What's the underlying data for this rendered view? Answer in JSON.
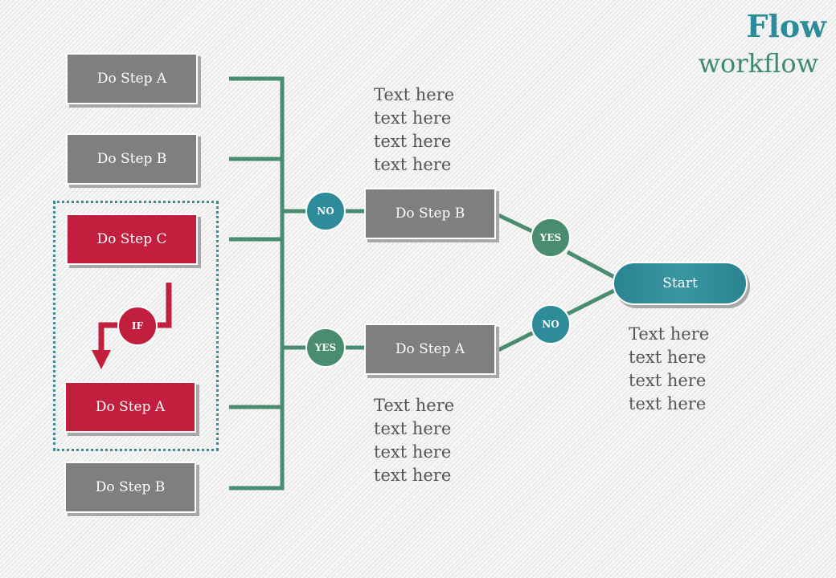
{
  "header": {
    "title": "Flow",
    "subtitle": "workflow"
  },
  "left_steps": [
    {
      "label": "Do Step A",
      "style": "gray"
    },
    {
      "label": "Do Step B",
      "style": "gray"
    },
    {
      "label": "Do Step C",
      "style": "red"
    },
    {
      "label": "Do Step A",
      "style": "red"
    },
    {
      "label": "Do Step B",
      "style": "gray"
    }
  ],
  "if_label": "IF",
  "middle_steps": [
    {
      "label": "Do Step B",
      "decision_in": "NO",
      "decision_out": "YES"
    },
    {
      "label": "Do Step A",
      "decision_in": "YES",
      "decision_out": "NO"
    }
  ],
  "start": {
    "label": "Start"
  },
  "notes": {
    "top": [
      "Text here",
      "text here",
      "text here",
      "text here"
    ],
    "bottom": [
      "Text here",
      "text here",
      "text here",
      "text here"
    ],
    "right": [
      "Text here",
      "text here",
      "text here",
      "text here"
    ]
  },
  "colors": {
    "line": "#4a8c70",
    "teal": "#2e8c9a",
    "red": "#c21e3e",
    "gray": "#7f7f7f"
  }
}
